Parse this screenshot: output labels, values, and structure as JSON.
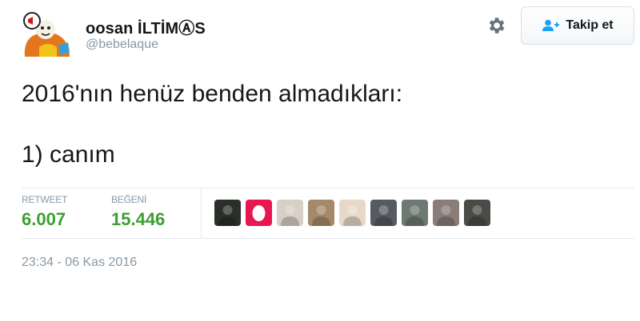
{
  "author": {
    "display_name": "oosan İLTİMⒶS",
    "handle": "@bebelaque"
  },
  "actions": {
    "settings_icon": "gear-icon",
    "follow_icon": "add-user-icon",
    "follow_label": "Takip et"
  },
  "tweet": {
    "text": "2016'nın henüz benden almadıkları:\n\n1) canım"
  },
  "stats": {
    "retweet_label": "RETWEET",
    "retweet_count": "6.007",
    "like_label": "BEĞENİ",
    "like_count": "15.446"
  },
  "likers": [
    {
      "color": "#2b2f2a"
    },
    {
      "color": "#e8174f"
    },
    {
      "color": "#d8cfc6"
    },
    {
      "color": "#a58a6a"
    },
    {
      "color": "#e6d9c8"
    },
    {
      "color": "#555b60"
    },
    {
      "color": "#6c7a72"
    },
    {
      "color": "#8a7c76"
    },
    {
      "color": "#4a4a46"
    }
  ],
  "timestamp": "23:34 - 06 Kas 2016",
  "colors": {
    "accent": "#1da1f2",
    "stat_green": "#3b9f2f",
    "muted": "#8899a6"
  }
}
